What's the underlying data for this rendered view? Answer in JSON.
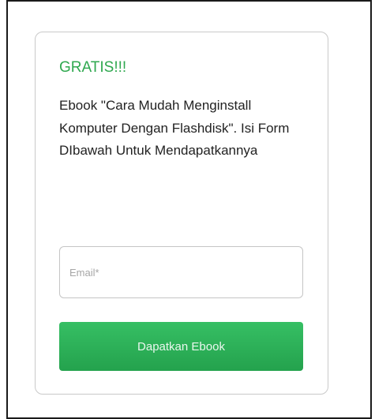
{
  "promo": {
    "heading": "GRATIS!!!",
    "description": "Ebook \"Cara Mudah Menginstall Komputer Dengan Flashdisk\". Isi Form DIbawah Untuk Mendapatkannya",
    "email_placeholder": "Email*",
    "email_value": "",
    "submit_label": "Dapatkan Ebook"
  },
  "colors": {
    "heading": "#2fa84f",
    "button": "#2db35a",
    "card_border": "#c9c9c9"
  }
}
